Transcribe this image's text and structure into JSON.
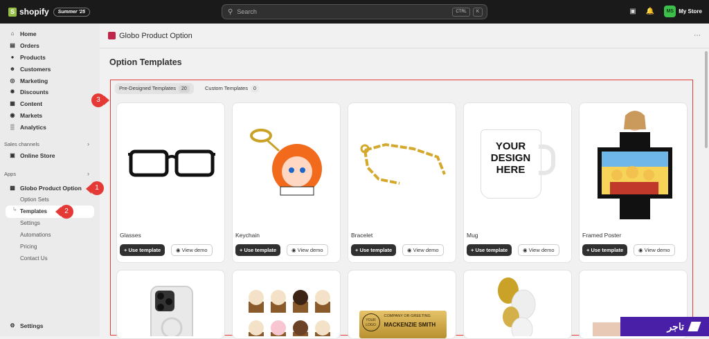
{
  "topbar": {
    "brand": "shopify",
    "edition": "Summer '25",
    "search_placeholder": "Search",
    "shortcut_keys": [
      "CTRL",
      "K"
    ],
    "avatar_initials": "MS",
    "store_name": "My Store"
  },
  "sidebar": {
    "items": [
      {
        "label": "Home",
        "icon": "home-icon"
      },
      {
        "label": "Orders",
        "icon": "orders-icon"
      },
      {
        "label": "Products",
        "icon": "tag-icon"
      },
      {
        "label": "Customers",
        "icon": "person-icon"
      },
      {
        "label": "Marketing",
        "icon": "target-icon"
      },
      {
        "label": "Discounts",
        "icon": "discount-icon"
      },
      {
        "label": "Content",
        "icon": "content-icon"
      },
      {
        "label": "Markets",
        "icon": "globe-icon"
      },
      {
        "label": "Analytics",
        "icon": "chart-icon"
      }
    ],
    "sales_channels_label": "Sales channels",
    "online_store": "Online Store",
    "apps_label": "Apps",
    "app_name": "Globo Product Option",
    "app_subitems": [
      "Option Sets",
      "Templates",
      "Settings",
      "Automations",
      "Pricing",
      "Contact Us"
    ],
    "settings": "Settings"
  },
  "main": {
    "app_title": "Globo Product Option",
    "page_title": "Option Templates",
    "tabs": [
      {
        "label": "Pre-Designed Templates",
        "count": "20"
      },
      {
        "label": "Custom Templates",
        "count": "0"
      }
    ],
    "use_template": "Use template",
    "view_demo": "View demo",
    "templates": [
      {
        "title": "Glasses"
      },
      {
        "title": "Keychain"
      },
      {
        "title": "Bracelet"
      },
      {
        "title": "Mug",
        "image_text": [
          "YOUR",
          "DESIGN",
          "HERE"
        ]
      },
      {
        "title": "Framed Poster"
      }
    ],
    "nameplate_text": [
      "COMPANY OR GREETING",
      "MACKENZIE SMITH",
      "YOUR LOGO"
    ]
  },
  "markers": [
    "1",
    "2",
    "3"
  ],
  "watermark": "تاجر"
}
